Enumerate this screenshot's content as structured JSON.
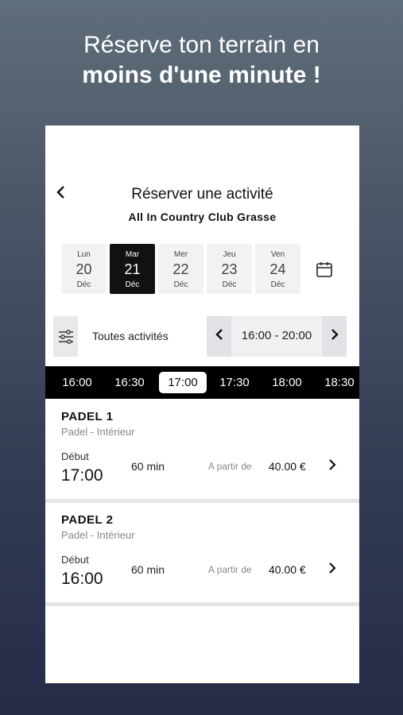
{
  "headline": {
    "line1": "Réserve ton terrain en",
    "line2": "moins d'une minute !"
  },
  "header": {
    "back_icon": "chevron-left-icon",
    "title": "Réserver une activité",
    "subtitle": "All In Country Club Grasse"
  },
  "days": [
    {
      "name": "Lun",
      "num": "20",
      "month": "Déc",
      "active": false
    },
    {
      "name": "Mar",
      "num": "21",
      "month": "Déc",
      "active": true
    },
    {
      "name": "Mer",
      "num": "22",
      "month": "Déc",
      "active": false
    },
    {
      "name": "Jeu",
      "num": "23",
      "month": "Déc",
      "active": false
    },
    {
      "name": "Ven",
      "num": "24",
      "month": "Déc",
      "active": false
    }
  ],
  "filter": {
    "icon": "sliders-icon",
    "label": "Toutes activités",
    "range": "16:00 - 20:00",
    "prev": "‹",
    "next": "›"
  },
  "time_slots": [
    "16:00",
    "16:30",
    "17:00",
    "17:30",
    "18:00",
    "18:30"
  ],
  "selected_slot": "17:00",
  "cards": [
    {
      "name": "PADEL 1",
      "type": "Padel - Intérieur",
      "start_label": "Début",
      "start": "17:00",
      "duration": "60 min",
      "from_label": "A partir de",
      "price": "40.00 €"
    },
    {
      "name": "PADEL 2",
      "type": "Padel - Intérieur",
      "start_label": "Début",
      "start": "16:00",
      "duration": "60 min",
      "from_label": "A partir de",
      "price": "40.00 €"
    }
  ]
}
